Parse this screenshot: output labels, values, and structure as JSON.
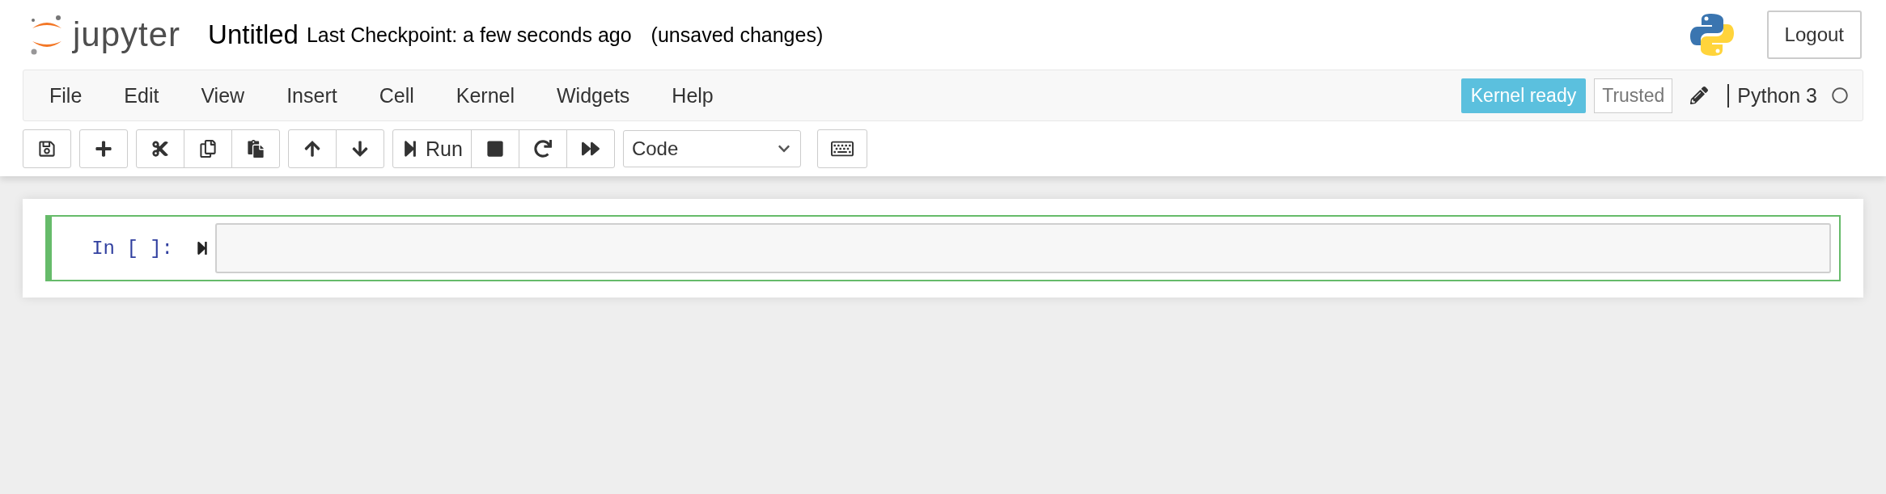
{
  "header": {
    "logo_text": "jupyter",
    "notebook_name": "Untitled",
    "checkpoint": "Last Checkpoint: a few seconds ago",
    "autosave_status": "(unsaved changes)",
    "logout": "Logout"
  },
  "menubar": {
    "items": [
      "File",
      "Edit",
      "View",
      "Insert",
      "Cell",
      "Kernel",
      "Widgets",
      "Help"
    ],
    "notification": "Kernel ready",
    "trusted": "Trusted",
    "kernel_name": "Python 3",
    "kernel_busy": false
  },
  "toolbar": {
    "groups": [
      {
        "buttons": [
          {
            "kind": "save"
          }
        ]
      },
      {
        "buttons": [
          {
            "kind": "insert"
          }
        ]
      },
      {
        "buttons": [
          {
            "kind": "cut"
          },
          {
            "kind": "copy"
          },
          {
            "kind": "paste"
          }
        ]
      },
      {
        "buttons": [
          {
            "kind": "up"
          },
          {
            "kind": "down"
          }
        ]
      },
      {
        "buttons": [
          {
            "kind": "run",
            "label": "Run"
          },
          {
            "kind": "stop"
          },
          {
            "kind": "restart"
          },
          {
            "kind": "run-all"
          }
        ]
      }
    ],
    "cell_type": "Code"
  },
  "cells": [
    {
      "prompt": "In [ ]:",
      "selected": true
    }
  ]
}
